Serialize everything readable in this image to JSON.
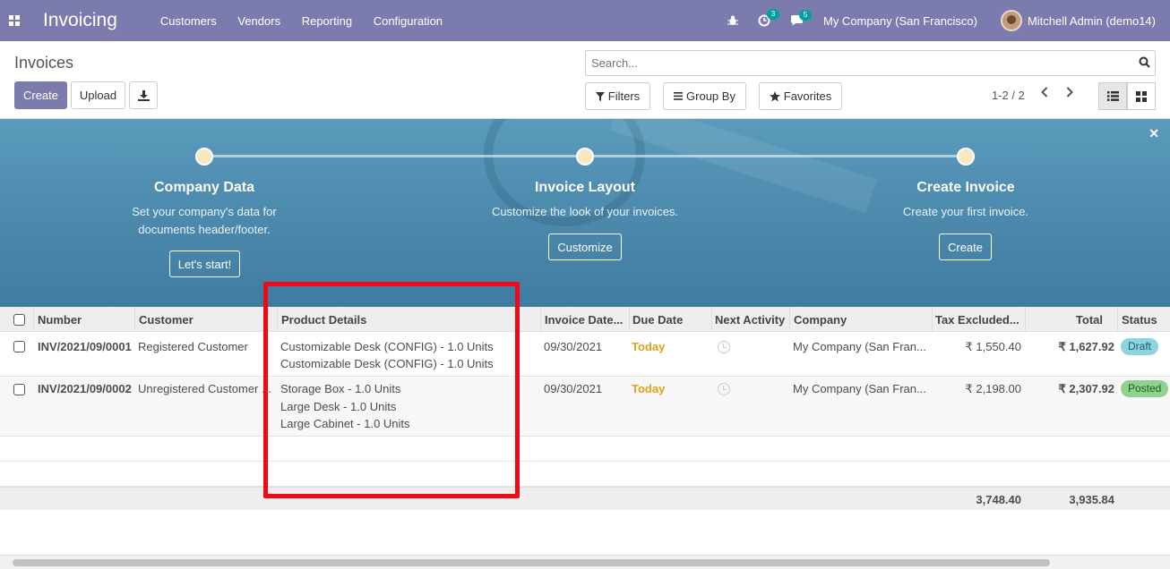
{
  "navbar": {
    "app_title": "Invoicing",
    "menu": [
      "Customers",
      "Vendors",
      "Reporting",
      "Configuration"
    ],
    "activity_count": "3",
    "message_count": "5",
    "company": "My Company (San Francisco)",
    "user": "Mitchell Admin (demo14)"
  },
  "control_panel": {
    "title": "Invoices",
    "create_label": "Create",
    "upload_label": "Upload",
    "search_placeholder": "Search...",
    "filters_label": "Filters",
    "groupby_label": "Group By",
    "favorites_label": "Favorites",
    "pager": "1-2 / 2"
  },
  "banner": {
    "steps": [
      {
        "title": "Company Data",
        "desc1": "Set your company's data for",
        "desc2": "documents header/footer.",
        "button": "Let's start!"
      },
      {
        "title": "Invoice Layout",
        "desc1": "Customize the look of your invoices.",
        "desc2": "",
        "button": "Customize"
      },
      {
        "title": "Create Invoice",
        "desc1": "Create your first invoice.",
        "desc2": "",
        "button": "Create"
      }
    ]
  },
  "table": {
    "columns": [
      "Number",
      "Customer",
      "Product Details",
      "Invoice Date...",
      "Due Date",
      "Next Activity",
      "Company",
      "Tax Excluded...",
      "Total",
      "Status"
    ],
    "rows": [
      {
        "number": "INV/2021/09/0001",
        "customer": "Registered Customer",
        "products": [
          "Customizable Desk (CONFIG) - 1.0 Units",
          "Customizable Desk (CONFIG) - 1.0 Units"
        ],
        "invoice_date": "09/30/2021",
        "due_date": "Today",
        "company": "My Company (San Fran...",
        "tax_excluded": "₹ 1,550.40",
        "total": "₹ 1,627.92",
        "status": "Draft"
      },
      {
        "number": "INV/2021/09/0002",
        "customer": "Unregistered Customer ...",
        "products": [
          "Storage Box - 1.0 Units",
          "Large Desk - 1.0 Units",
          "Large Cabinet - 1.0 Units"
        ],
        "invoice_date": "09/30/2021",
        "due_date": "Today",
        "company": "My Company (San Fran...",
        "tax_excluded": "₹ 2,198.00",
        "total": "₹ 2,307.92",
        "status": "Posted"
      }
    ],
    "totals": {
      "tax_excluded": "3,748.40",
      "total": "3,935.84"
    }
  }
}
